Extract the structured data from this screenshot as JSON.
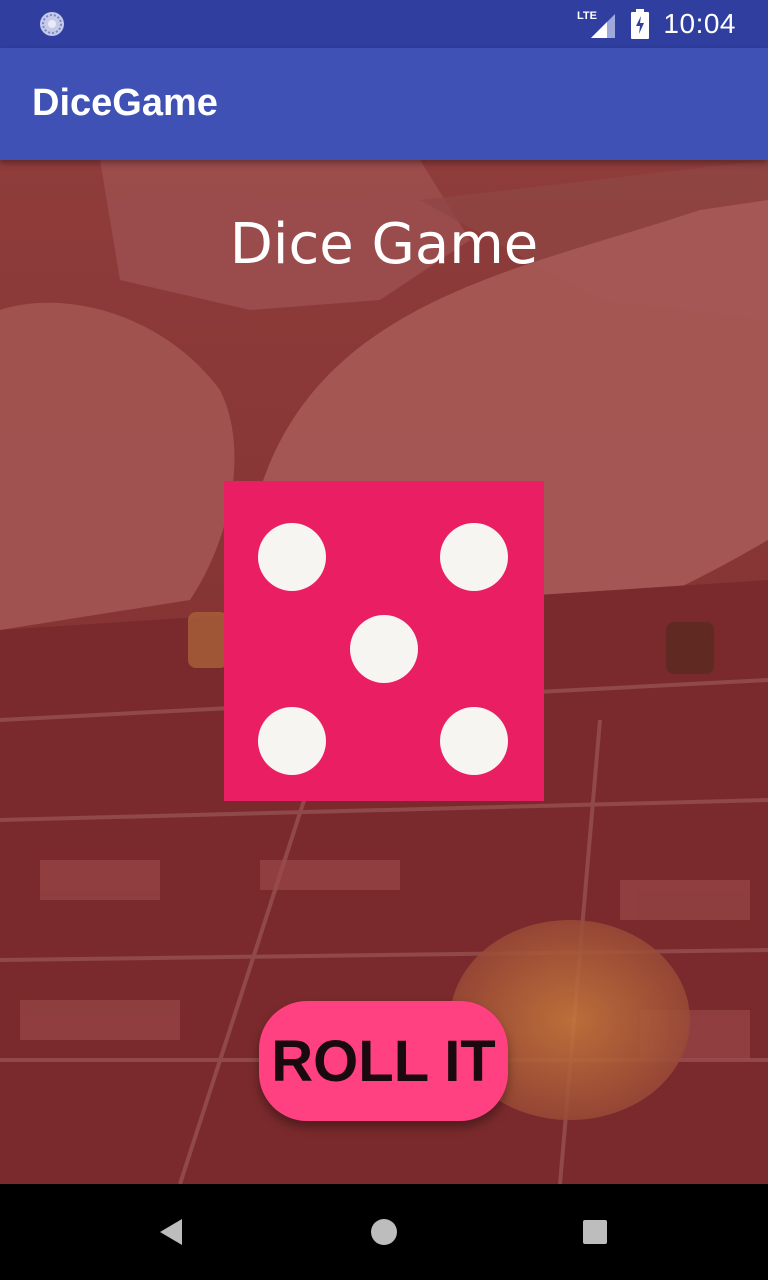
{
  "status_bar": {
    "time": "10:04",
    "network_label": "LTE",
    "icons": [
      "sync-icon",
      "lte-signal-icon",
      "battery-charging-icon"
    ]
  },
  "app_bar": {
    "title": "DiceGame"
  },
  "main": {
    "heading": "Dice Game",
    "die": {
      "value": 5,
      "color": "#e91e63",
      "pip_color": "#f7f5f2"
    },
    "roll_button_label": "ROLL IT"
  },
  "nav_bar": {
    "buttons": [
      "back-icon",
      "home-icon",
      "recents-icon"
    ]
  },
  "colors": {
    "status_bar": "#303f9f",
    "app_bar": "#3f51b5",
    "accent": "#ff4081",
    "overlay": "#8a3b38"
  }
}
